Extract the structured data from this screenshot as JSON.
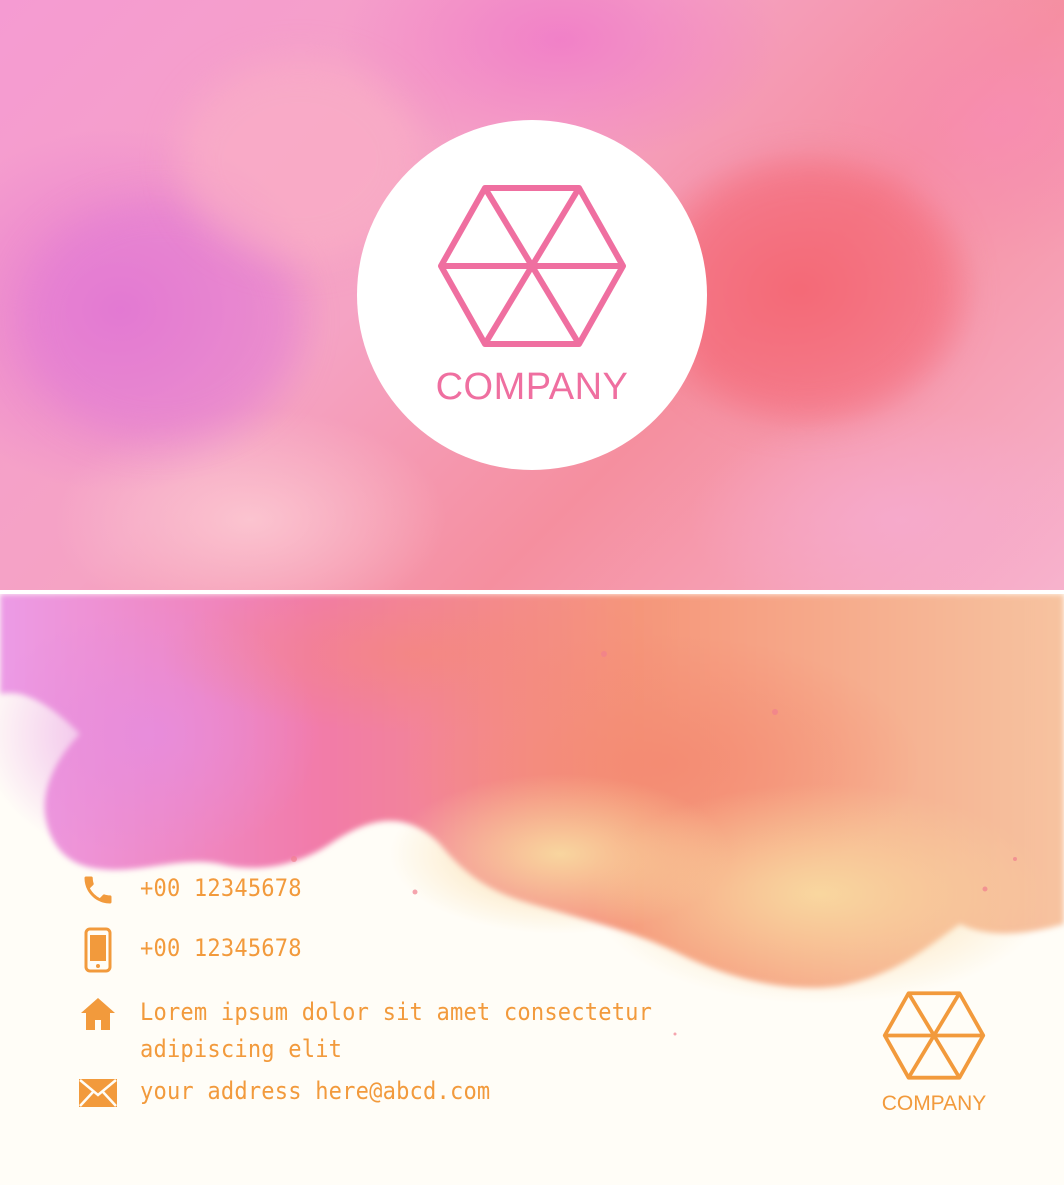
{
  "front": {
    "logo_icon": "hexagon-logo-icon",
    "company_name": "COMPANY",
    "accent_color": "#ef6fa0"
  },
  "back": {
    "accent_color": "#f29a3c",
    "contacts": [
      {
        "icon": "phone-icon",
        "text": "+00 12345678"
      },
      {
        "icon": "mobile-icon",
        "text": "+00 12345678"
      },
      {
        "icon": "home-icon",
        "lines": [
          "Lorem ipsum dolor sit amet consectetur",
          "adipiscing elit"
        ]
      },
      {
        "icon": "mail-icon",
        "text": "your address here@abcd.com"
      }
    ],
    "logo_icon": "hexagon-logo-icon",
    "company_name": "COMPANY"
  }
}
